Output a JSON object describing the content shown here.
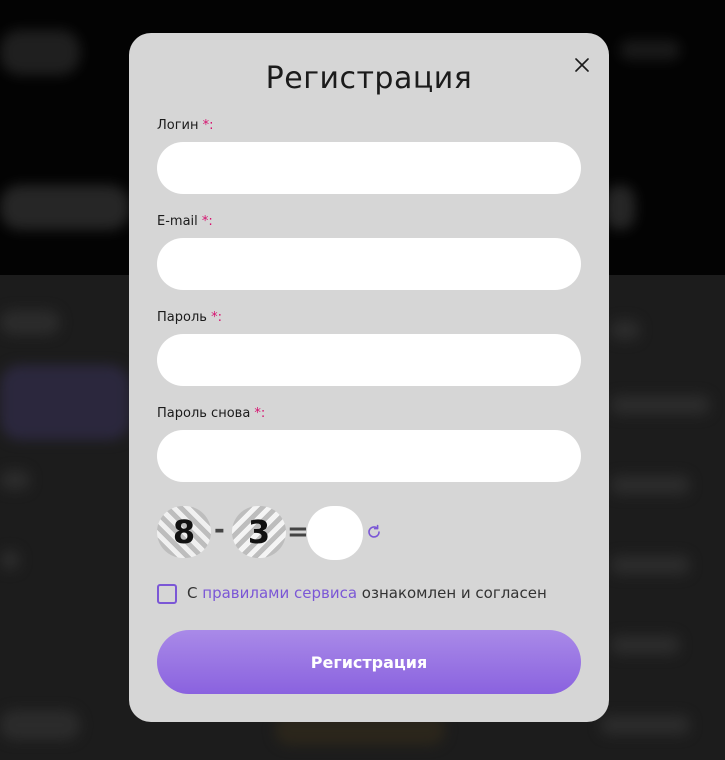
{
  "modal": {
    "title": "Регистрация",
    "fields": [
      {
        "label": "Логин",
        "required_mark": "*:",
        "value": "",
        "placeholder": ""
      },
      {
        "label": "E-mail",
        "required_mark": "*:",
        "value": "",
        "placeholder": ""
      },
      {
        "label": "Пароль",
        "required_mark": "*:",
        "value": "",
        "placeholder": ""
      },
      {
        "label": "Пароль снова",
        "required_mark": "*:",
        "value": "",
        "placeholder": ""
      }
    ],
    "captcha": {
      "first_digit": "8",
      "operator": "-",
      "second_digit": "3",
      "equals": "=",
      "answer": ""
    },
    "agreement": {
      "prefix": "С",
      "link_text": "правилами сервиса",
      "suffix": "ознакомлен и согласен",
      "checked": false
    },
    "submit_label": "Регистрация"
  },
  "colors": {
    "modal_bg": "#d6d6d6",
    "accent": "#7b57d6",
    "required": "#d6106e",
    "button_gradient_top": "#a98ae8",
    "button_gradient_bottom": "#8a62df"
  },
  "icons": [
    "close-icon",
    "refresh-icon",
    "checkbox"
  ]
}
